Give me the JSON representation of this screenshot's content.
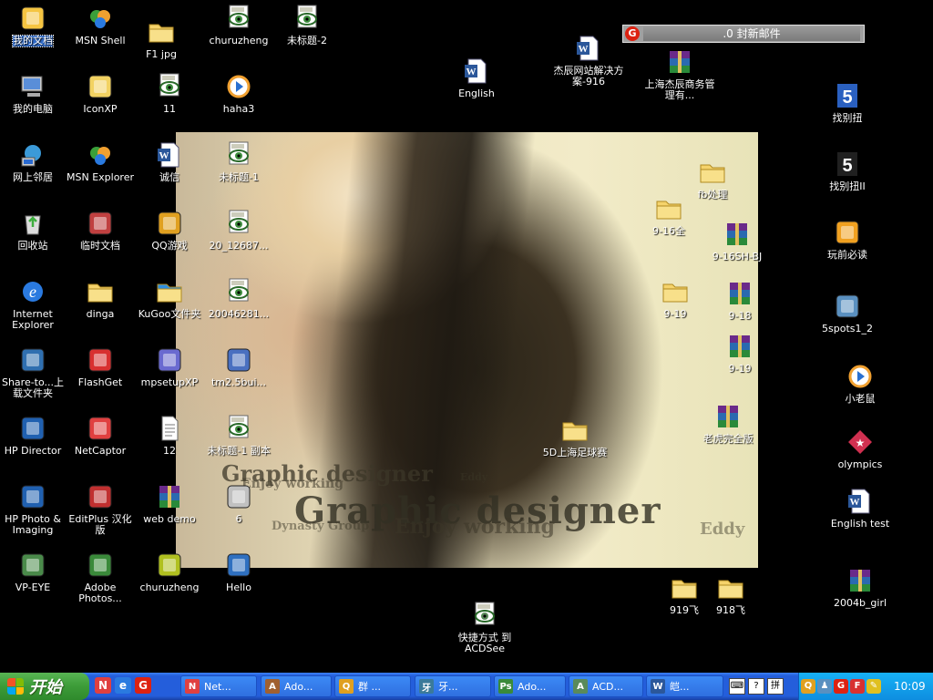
{
  "colors": {
    "desktop": "#000000",
    "taskbar": "#245edb",
    "start": "#3c9b38",
    "selection": "#316ac5"
  },
  "mail_bar": {
    "text": ".0 封新邮件",
    "logo": "G"
  },
  "desktop_icons": [
    {
      "label": "我的文档",
      "icon": "my-documents-icon",
      "color": "#f5c542",
      "selected": true
    },
    {
      "label": "MSN Shell",
      "icon": "msn-icon",
      "color": "#3a9f3a"
    },
    {
      "label": "F1 jpg",
      "icon": "folder-icon",
      "color": "#f5d36b"
    },
    {
      "label": "churuzheng",
      "icon": "acdsee-image-icon",
      "color": "#3e8e3e"
    },
    {
      "label": "未标题-2",
      "icon": "acdsee-image-icon",
      "color": "#3e8e3e"
    },
    {
      "label": "我的电脑",
      "icon": "my-computer-icon",
      "color": "#5a8ed8"
    },
    {
      "label": "IconXP",
      "icon": "iconxp-icon",
      "color": "#f2d262"
    },
    {
      "label": "11",
      "icon": "acdsee-gif-icon",
      "color": "#3e8e3e"
    },
    {
      "label": "haha3",
      "icon": "media-player-icon",
      "color": "#f0a030"
    },
    {
      "label": "网上邻居",
      "icon": "network-icon",
      "color": "#3b9ad8"
    },
    {
      "label": "MSN Explorer",
      "icon": "msn-butterfly-icon",
      "color": "#3f80d8"
    },
    {
      "label": "诚信",
      "icon": "word-doc-icon",
      "color": "#2b579a"
    },
    {
      "label": "未标题-1",
      "icon": "acdsee-image-icon",
      "color": "#3e8e3e"
    },
    {
      "label": "回收站",
      "icon": "recycle-bin-icon",
      "color": "#3eae3e"
    },
    {
      "label": "临时文档",
      "icon": "temp-doc-icon",
      "color": "#c04040"
    },
    {
      "label": "QQ游戏",
      "icon": "qq-game-icon",
      "color": "#e0a020"
    },
    {
      "label": "20_12687...",
      "icon": "acdsee-image-icon",
      "color": "#3e8e3e"
    },
    {
      "label": "Internet Explorer",
      "icon": "internet-explorer-icon",
      "color": "#2a7ae0"
    },
    {
      "label": "dinga",
      "icon": "folder-icon",
      "color": "#f5d36b"
    },
    {
      "label": "KuGoo文件夹",
      "icon": "kugoo-folder-icon",
      "color": "#2f8fe0"
    },
    {
      "label": "20046281...",
      "icon": "acdsee-gif-icon",
      "color": "#3e8e3e"
    },
    {
      "label": "Share-to...上载文件夹",
      "icon": "hp-share-icon",
      "color": "#2f6fb0"
    },
    {
      "label": "FlashGet",
      "icon": "flashget-icon",
      "color": "#d83030"
    },
    {
      "label": "mpsetupXP",
      "icon": "setup-icon",
      "color": "#6a6ad0"
    },
    {
      "label": "tm2.5bui...",
      "icon": "installer-icon",
      "color": "#4a70c0"
    },
    {
      "label": "HP Director",
      "icon": "hp-director-icon",
      "color": "#2060b0"
    },
    {
      "label": "NetCaptor",
      "icon": "netcaptor-icon",
      "color": "#e04040"
    },
    {
      "label": "12",
      "icon": "text-file-icon",
      "color": "#e8e8e8"
    },
    {
      "label": "未标题-1 副本",
      "icon": "acdsee-image-icon",
      "color": "#3e8e3e"
    },
    {
      "label": "HP Photo & Imaging",
      "icon": "hp-photo-icon",
      "color": "#2060b0"
    },
    {
      "label": "EditPlus 汉化版",
      "icon": "editplus-icon",
      "color": "#c03030"
    },
    {
      "label": "web demo",
      "icon": "winrar-icon",
      "color": "#8a3aa0"
    },
    {
      "label": "6",
      "icon": "flash-file-icon",
      "color": "#c0c0c0"
    },
    {
      "label": "VP-EYE",
      "icon": "vp-eye-icon",
      "color": "#4a8a4a"
    },
    {
      "label": "Adobe Photos...",
      "icon": "photoshop-icon",
      "color": "#3a8a3a"
    },
    {
      "label": "churuzheng",
      "icon": "image-file-icon",
      "color": "#b0c020"
    },
    {
      "label": "Hello",
      "icon": "hello-app-icon",
      "color": "#2f70c0"
    },
    {
      "label": "English",
      "icon": "word-doc-icon",
      "color": "#2b579a"
    },
    {
      "label": "杰辰网站解决方案-916",
      "icon": "word-doc-icon",
      "color": "#2b579a"
    },
    {
      "label": "上海杰辰商务管理有...",
      "icon": "winrar-icon",
      "color": "#8a3aa0"
    },
    {
      "label": "找别扭",
      "icon": "zhaobieniu-icon",
      "color": "#2a60c0"
    },
    {
      "label": "fb处理",
      "icon": "folder-icon",
      "color": "#f5d36b"
    },
    {
      "label": "9-16全",
      "icon": "folder-icon",
      "color": "#f5d36b"
    },
    {
      "label": "9-16SH-BJ",
      "icon": "winrar-icon",
      "color": "#8a3aa0"
    },
    {
      "label": "找别扭II",
      "icon": "zhaobieniu-icon",
      "color": "#202020"
    },
    {
      "label": "玩前必读",
      "icon": "chocobo-icon",
      "color": "#f0a020"
    },
    {
      "label": "9-19",
      "icon": "folder-icon",
      "color": "#f5d36b"
    },
    {
      "label": "9-18",
      "icon": "winrar-icon",
      "color": "#8a3aa0"
    },
    {
      "label": "5spots1_2",
      "icon": "setup-cd-icon",
      "color": "#5a90c0"
    },
    {
      "label": "9-19",
      "icon": "winrar-icon",
      "color": "#8a3aa0"
    },
    {
      "label": "小老鼠",
      "icon": "media-player-icon",
      "color": "#f0a030"
    },
    {
      "label": "老虎完全版",
      "icon": "winrar-icon",
      "color": "#8a3aa0"
    },
    {
      "label": "5D上海足球赛",
      "icon": "folder-icon",
      "color": "#f5d36b"
    },
    {
      "label": "olympics",
      "icon": "olympics-icon",
      "color": "#d03050"
    },
    {
      "label": "English test",
      "icon": "word-doc-icon",
      "color": "#2b579a"
    },
    {
      "label": "2004b_girl",
      "icon": "winrar-icon",
      "color": "#8a3aa0"
    },
    {
      "label": "919飞",
      "icon": "folder-icon",
      "color": "#f5d36b"
    },
    {
      "label": "918飞",
      "icon": "folder-icon",
      "color": "#f5d36b"
    },
    {
      "label": "快捷方式 到 ACDSee",
      "icon": "acdsee-icon",
      "color": "#5a8a5a"
    }
  ],
  "wallpaper": {
    "text1": "Graphic designer",
    "text2": "Enjoy working",
    "text3": "Graphic designer",
    "text4": "Enjoy working",
    "text5": "Dynasty Group",
    "text6": "Eddy",
    "text7": "Eddy"
  },
  "taskbar": {
    "start_label": "开始",
    "quick_launch": [
      {
        "icon": "netcaptor-icon",
        "color": "#e04040",
        "glyph": "N"
      },
      {
        "icon": "internet-explorer-icon",
        "color": "#2a7ae0",
        "glyph": "e"
      },
      {
        "icon": "mail-icon",
        "color": "#d21",
        "glyph": "G"
      }
    ],
    "tasks": [
      {
        "label": "Net...",
        "icon": "netcaptor-icon",
        "color": "#e04040",
        "glyph": "N"
      },
      {
        "label": "Ado...",
        "icon": "adobe-icon",
        "color": "#a06030",
        "glyph": "A"
      },
      {
        "label": "群 ...",
        "icon": "qq-icon",
        "color": "#e0a020",
        "glyph": "Q"
      },
      {
        "label": "牙...",
        "icon": "task-icon",
        "color": "#3a7a9a",
        "glyph": "牙"
      },
      {
        "label": "Ado...",
        "icon": "photoshop-icon",
        "color": "#3a8a3a",
        "glyph": "Ps"
      },
      {
        "label": "ACD...",
        "icon": "acdsee-icon",
        "color": "#5a8a5a",
        "glyph": "A"
      },
      {
        "label": "皑...",
        "icon": "word-icon",
        "color": "#2b579a",
        "glyph": "W"
      }
    ],
    "lang_buttons": [
      {
        "icon": "keyboard-icon",
        "glyph": "⌨"
      },
      {
        "icon": "help-icon",
        "glyph": "?"
      },
      {
        "icon": "ime-icon",
        "glyph": "拼"
      }
    ],
    "tray": [
      {
        "icon": "qq-tray-icon",
        "color": "#e0a020",
        "glyph": "Q"
      },
      {
        "icon": "users-tray-icon",
        "color": "#5a90c0",
        "glyph": "♟"
      },
      {
        "icon": "mail-tray-icon",
        "color": "#d21",
        "glyph": "G"
      },
      {
        "icon": "flashget-tray-icon",
        "color": "#d83030",
        "glyph": "F"
      },
      {
        "icon": "pencil-tray-icon",
        "color": "#e0c020",
        "glyph": "✎"
      }
    ],
    "clock": "10:09"
  }
}
